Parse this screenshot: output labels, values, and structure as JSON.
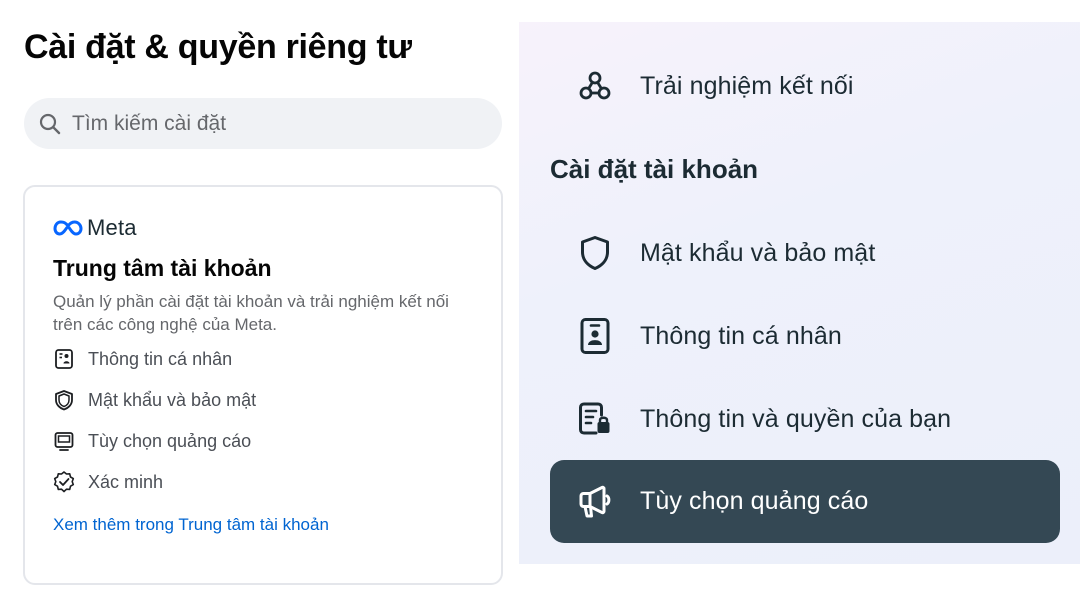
{
  "left_panel": {
    "title": "Cài đặt & quyền riêng tư",
    "search": {
      "placeholder": "Tìm kiếm cài đặt",
      "value": "",
      "icon": "search-icon"
    },
    "accounts_center_card": {
      "brand": "Meta",
      "brand_icon": "meta-infinity-logo",
      "title": "Trung tâm tài khoản",
      "description": "Quản lý phần cài đặt tài khoản và trải nghiệm kết nối trên các công nghệ của Meta.",
      "items": [
        {
          "label": "Thông tin cá nhân",
          "icon": "id-card-icon"
        },
        {
          "label": "Mật khẩu và bảo mật",
          "icon": "shield-icon"
        },
        {
          "label": "Tùy chọn quảng cáo",
          "icon": "monitor-icon"
        },
        {
          "label": "Xác minh",
          "icon": "verified-badge-icon"
        }
      ],
      "link": "Xem thêm trong Trung tâm tài khoản"
    }
  },
  "right_panel": {
    "connected_experiences": {
      "label": "Trải nghiệm kết nối",
      "icon": "connected-nodes-icon"
    },
    "section_heading": "Cài đặt tài khoản",
    "items": [
      {
        "label": "Mật khẩu và bảo mật",
        "icon": "shield-icon"
      },
      {
        "label": "Thông tin cá nhân",
        "icon": "id-card-icon"
      },
      {
        "label": "Thông tin và quyền của bạn",
        "icon": "document-lock-icon"
      },
      {
        "label": "Tùy chọn quảng cáo",
        "icon": "megaphone-icon",
        "selected": true
      }
    ]
  },
  "colors": {
    "link": "#0064d1",
    "meta_blue": "#0866ff",
    "selected_bg": "#344854",
    "search_bg": "#f0f2f5"
  }
}
